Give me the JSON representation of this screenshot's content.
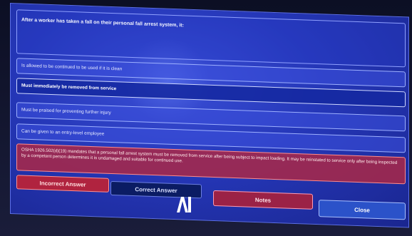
{
  "quiz": {
    "question": "After a worker has taken a fall on their personal fall arrest system, it:",
    "options": [
      {
        "label": "Is allowed to be continued to be used if it is clean",
        "selected": false
      },
      {
        "label": "Must immediately be removed from service",
        "selected": true
      },
      {
        "label": "Must be praised for preventing further injury",
        "selected": false
      },
      {
        "label": "Can be given to an entry-level employee",
        "selected": false
      }
    ],
    "feedback": "OSHA 1926.502(d)(19) mandates that a personal fall arrest system must be removed from service after being subject to impact loading. It may be reinstated to service only after being inspected by a competent person determines it is undamaged and suitable for continued use."
  },
  "buttons": {
    "incorrect": "Incorrect Answer",
    "correct": "Correct Answer",
    "notes": "Notes",
    "close": "Close"
  },
  "colors": {
    "screen_bg": "#2537b8",
    "feedback_bg": "#aa2846",
    "close_button": "#2b52c9"
  }
}
